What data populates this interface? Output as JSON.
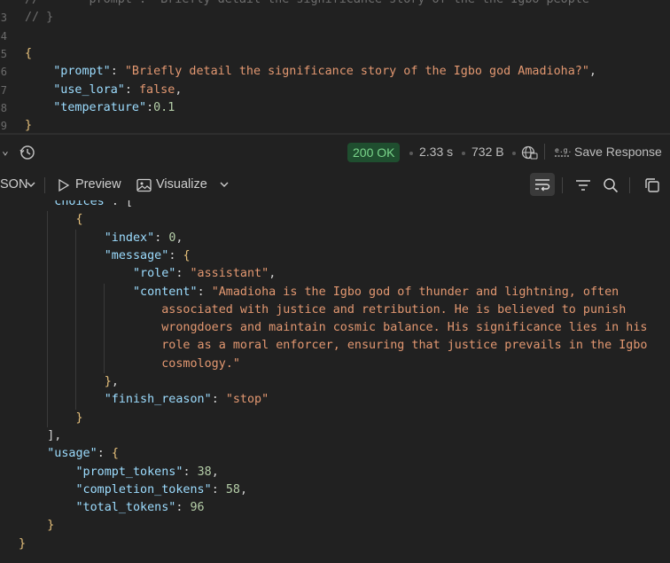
{
  "request": {
    "lines": [
      {
        "num": "",
        "parts": [
          {
            "t": "//      \"prompt\": \"Briefly detail the significance story of the the Igbo people\"",
            "c": "c-comment"
          }
        ]
      },
      {
        "num": "3",
        "parts": [
          {
            "t": "// }",
            "c": "c-comment"
          }
        ]
      },
      {
        "num": "4",
        "parts": []
      },
      {
        "num": "5",
        "parts": [
          {
            "t": "{",
            "c": "brace"
          }
        ]
      },
      {
        "num": "6",
        "parts": [
          {
            "t": "    ",
            "c": "c-punc"
          },
          {
            "t": "\"prompt\"",
            "c": "c-key"
          },
          {
            "t": ": ",
            "c": "c-punc"
          },
          {
            "t": "\"Briefly detail the significance story of the Igbo god Amadioha?\"",
            "c": "c-str"
          },
          {
            "t": ",",
            "c": "c-punc"
          }
        ]
      },
      {
        "num": "7",
        "parts": [
          {
            "t": "    ",
            "c": "c-punc"
          },
          {
            "t": "\"use_lora\"",
            "c": "c-key"
          },
          {
            "t": ": ",
            "c": "c-punc"
          },
          {
            "t": "false",
            "c": "c-kw"
          },
          {
            "t": ",",
            "c": "c-punc"
          }
        ]
      },
      {
        "num": "8",
        "parts": [
          {
            "t": "    ",
            "c": "c-punc"
          },
          {
            "t": "\"temperature\"",
            "c": "c-key"
          },
          {
            "t": ":",
            "c": "c-punc"
          },
          {
            "t": "0.1",
            "c": "c-num"
          }
        ]
      },
      {
        "num": "9",
        "parts": [
          {
            "t": "}",
            "c": "brace"
          }
        ]
      }
    ]
  },
  "meta": {
    "status": "200 OK",
    "time": "2.33 s",
    "size": "732 B",
    "save_label": "Save Response"
  },
  "toolbar": {
    "format_label": "SON",
    "preview_label": "Preview",
    "visualize_label": "Visualize"
  },
  "response": {
    "lines": [
      {
        "parts": [
          {
            "t": "    ",
            "c": "c-punc"
          },
          {
            "t": "\"choices\"",
            "c": "c-key"
          },
          {
            "t": ": [",
            "c": "c-punc"
          }
        ]
      },
      {
        "parts": [
          {
            "t": "        ",
            "c": "c-punc"
          },
          {
            "t": "{",
            "c": "brace"
          }
        ]
      },
      {
        "parts": [
          {
            "t": "            ",
            "c": "c-punc"
          },
          {
            "t": "\"index\"",
            "c": "c-key"
          },
          {
            "t": ": ",
            "c": "c-punc"
          },
          {
            "t": "0",
            "c": "c-num"
          },
          {
            "t": ",",
            "c": "c-punc"
          }
        ]
      },
      {
        "parts": [
          {
            "t": "            ",
            "c": "c-punc"
          },
          {
            "t": "\"message\"",
            "c": "c-key"
          },
          {
            "t": ": ",
            "c": "c-punc"
          },
          {
            "t": "{",
            "c": "brace"
          }
        ]
      },
      {
        "parts": [
          {
            "t": "                ",
            "c": "c-punc"
          },
          {
            "t": "\"role\"",
            "c": "c-key"
          },
          {
            "t": ": ",
            "c": "c-punc"
          },
          {
            "t": "\"assistant\"",
            "c": "c-str"
          },
          {
            "t": ",",
            "c": "c-punc"
          }
        ]
      },
      {
        "parts": [
          {
            "t": "                ",
            "c": "c-punc"
          },
          {
            "t": "\"content\"",
            "c": "c-key"
          },
          {
            "t": ": ",
            "c": "c-punc"
          },
          {
            "t": "\"Amadioha is the Igbo god of thunder and lightning, often",
            "c": "c-str"
          }
        ]
      },
      {
        "parts": [
          {
            "t": "                    ",
            "c": "c-punc"
          },
          {
            "t": "associated with justice and retribution. He is believed to punish",
            "c": "c-str"
          }
        ]
      },
      {
        "parts": [
          {
            "t": "                    ",
            "c": "c-punc"
          },
          {
            "t": "wrongdoers and maintain cosmic balance. His significance lies in his",
            "c": "c-str"
          }
        ]
      },
      {
        "parts": [
          {
            "t": "                    ",
            "c": "c-punc"
          },
          {
            "t": "role as a moral enforcer, ensuring that justice prevails in the Igbo",
            "c": "c-str"
          }
        ]
      },
      {
        "parts": [
          {
            "t": "                    ",
            "c": "c-punc"
          },
          {
            "t": "cosmology.\"",
            "c": "c-str"
          }
        ]
      },
      {
        "parts": [
          {
            "t": "            ",
            "c": "c-punc"
          },
          {
            "t": "}",
            "c": "brace"
          },
          {
            "t": ",",
            "c": "c-punc"
          }
        ]
      },
      {
        "parts": [
          {
            "t": "            ",
            "c": "c-punc"
          },
          {
            "t": "\"finish_reason\"",
            "c": "c-key"
          },
          {
            "t": ": ",
            "c": "c-punc"
          },
          {
            "t": "\"stop\"",
            "c": "c-str"
          }
        ]
      },
      {
        "parts": [
          {
            "t": "        ",
            "c": "c-punc"
          },
          {
            "t": "}",
            "c": "brace"
          }
        ]
      },
      {
        "parts": [
          {
            "t": "    ",
            "c": "c-punc"
          },
          {
            "t": "],",
            "c": "c-punc"
          }
        ]
      },
      {
        "parts": [
          {
            "t": "    ",
            "c": "c-punc"
          },
          {
            "t": "\"usage\"",
            "c": "c-key"
          },
          {
            "t": ": ",
            "c": "c-punc"
          },
          {
            "t": "{",
            "c": "brace"
          }
        ]
      },
      {
        "parts": [
          {
            "t": "        ",
            "c": "c-punc"
          },
          {
            "t": "\"prompt_tokens\"",
            "c": "c-key"
          },
          {
            "t": ": ",
            "c": "c-punc"
          },
          {
            "t": "38",
            "c": "c-num"
          },
          {
            "t": ",",
            "c": "c-punc"
          }
        ]
      },
      {
        "parts": [
          {
            "t": "        ",
            "c": "c-punc"
          },
          {
            "t": "\"completion_tokens\"",
            "c": "c-key"
          },
          {
            "t": ": ",
            "c": "c-punc"
          },
          {
            "t": "58",
            "c": "c-num"
          },
          {
            "t": ",",
            "c": "c-punc"
          }
        ]
      },
      {
        "parts": [
          {
            "t": "        ",
            "c": "c-punc"
          },
          {
            "t": "\"total_tokens\"",
            "c": "c-key"
          },
          {
            "t": ": ",
            "c": "c-punc"
          },
          {
            "t": "96",
            "c": "c-num"
          }
        ]
      },
      {
        "parts": [
          {
            "t": "    ",
            "c": "c-punc"
          },
          {
            "t": "}",
            "c": "brace"
          }
        ]
      },
      {
        "parts": [
          {
            "t": "}",
            "c": "brace"
          }
        ]
      }
    ]
  }
}
